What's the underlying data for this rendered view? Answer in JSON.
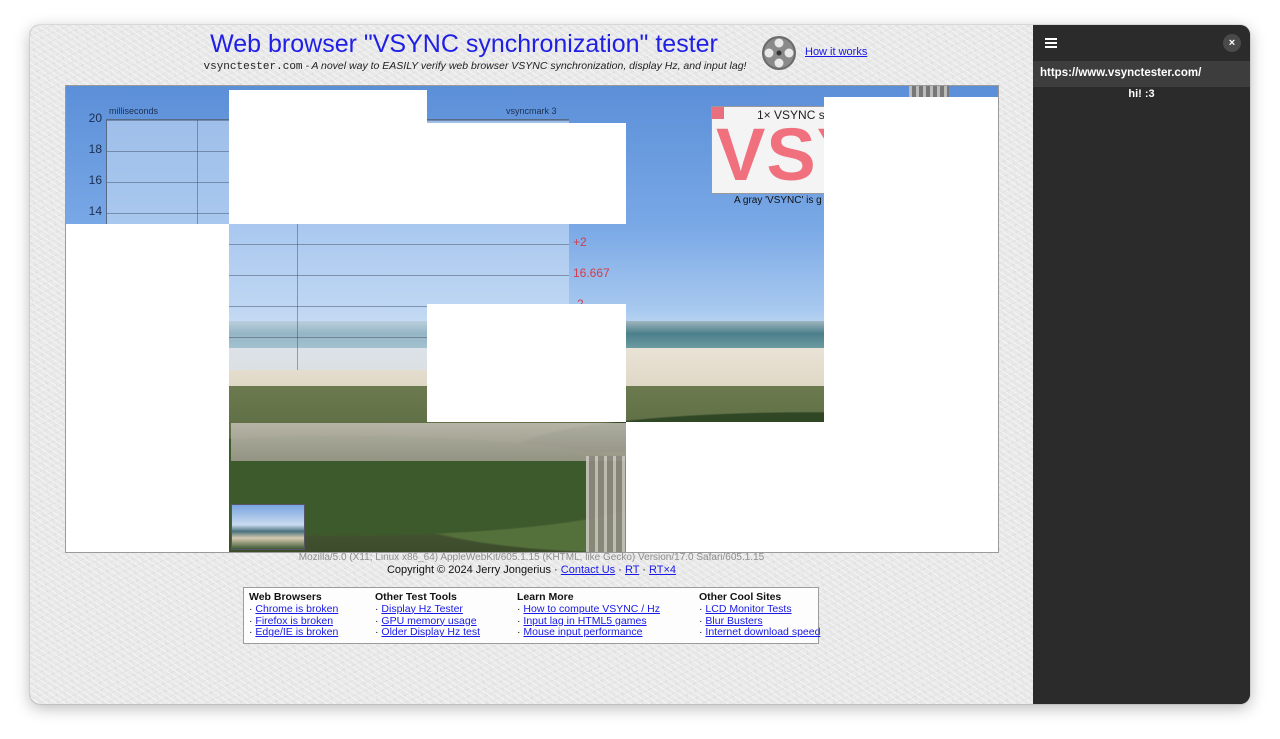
{
  "page": {
    "title": "Web browser \"VSYNC synchronization\" tester",
    "subtitle_domain": "vsynctester.com",
    "subtitle_text": " - A novel way to EASILY verify web browser VSYNC synchronization, display Hz, and input lag!",
    "how_it_works": "How it works"
  },
  "graph": {
    "unit_label": "milliseconds",
    "title": "vsyncmark 3",
    "y_ticks": [
      "20",
      "18",
      "16",
      "14"
    ],
    "right_ticks": [
      "+2",
      "16.667",
      "-2"
    ]
  },
  "vsync_box": {
    "header": "1× VSYNC s",
    "big_text": "VSY",
    "caption": "A gray 'VSYNC' is g"
  },
  "footer": {
    "user_agent": "Mozilla/5.0 (X11; Linux x86_64) AppleWebKit/605.1.15 (KHTML, like Gecko) Version/17.0 Safari/605.1.15",
    "copyright": "Copyright © 2024 Jerry Jongerius · ",
    "contact": "Contact Us",
    "sep1": " · ",
    "rt": "RT",
    "sep2": " · ",
    "rt4": "RT×4"
  },
  "links": {
    "web_browsers": {
      "header": "Web Browsers",
      "items": [
        "Chrome is broken",
        "Firefox is broken",
        "Edge/IE is broken"
      ]
    },
    "other_tools": {
      "header": "Other Test Tools",
      "items": [
        "Display Hz Tester",
        "GPU memory usage",
        "Older Display Hz test"
      ]
    },
    "learn_more": {
      "header": "Learn More",
      "items": [
        "How to compute VSYNC / Hz",
        "Input lag in HTML5 games",
        "Mouse input performance"
      ]
    },
    "cool_sites": {
      "header": "Other Cool Sites",
      "items": [
        "LCD Monitor Tests",
        "Blur Busters",
        "Internet download speed"
      ]
    },
    "bullet": "· "
  },
  "panel": {
    "menu_icon": "hamburger-menu-icon",
    "close_icon": "close-icon",
    "close_glyph": "×",
    "url": "https://www.vsynctester.com/",
    "greeting": "hi! :3"
  },
  "colors": {
    "title_blue": "#1f1fe6",
    "link_blue": "#1a1ae6",
    "accent_red": "#d23c4f",
    "panel_bg": "#2b2b2b"
  }
}
